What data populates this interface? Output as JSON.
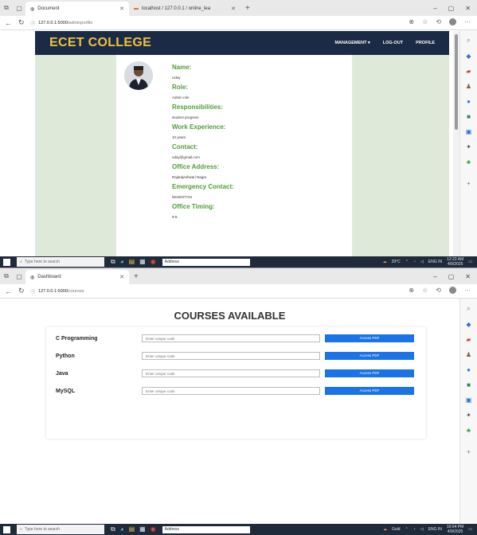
{
  "shot1": {
    "browser": {
      "tabs": [
        {
          "title": "Document",
          "active": true
        },
        {
          "title": "localhost / 127.0.0.1 / online_lea",
          "active": false
        }
      ],
      "url_host": "127.0.0.1:5000",
      "url_path": "/adminprofile"
    },
    "nav": {
      "brand": "ECET COLLEGE",
      "links": [
        "MANAGEMENT ▾",
        "LOG-OUT",
        "PROFILE"
      ]
    },
    "profile": [
      {
        "label": "Name:",
        "value": "Uday"
      },
      {
        "label": "Role:",
        "value": "Admin role"
      },
      {
        "label": "Responsibilities:",
        "value": "student progress"
      },
      {
        "label": "Work Experience:",
        "value": "10 years"
      },
      {
        "label": "Contact:",
        "value": "uday@gmail.com"
      },
      {
        "label": "Office Address:",
        "value": "Rajarajeshwari Nagar"
      },
      {
        "label": "Emergency Contact:",
        "value": "9618237734"
      },
      {
        "label": "Office Timing:",
        "value": "9-5"
      }
    ],
    "taskbar": {
      "search": "Type here to search",
      "address": "Address",
      "weather": "29°C",
      "lang": "ENG IN",
      "time": "12:22 AM",
      "date": "4/9/2025"
    }
  },
  "shot2": {
    "browser": {
      "tabs": [
        {
          "title": "Dashboard",
          "active": true
        }
      ],
      "url_host": "127.0.0.1:5000",
      "url_path": "/courses"
    },
    "title": "COURSES AVAILABLE",
    "courses": [
      {
        "name": "C Programming",
        "placeholder": "Enter unique code",
        "button": "Access PDF"
      },
      {
        "name": "Python",
        "placeholder": "Enter unique code",
        "button": "Access PDF"
      },
      {
        "name": "Java",
        "placeholder": "Enter unique code",
        "button": "Access PDF"
      },
      {
        "name": "MySQL",
        "placeholder": "Enter unique code",
        "button": "Access PDF"
      }
    ],
    "taskbar": {
      "search": "Type here to search",
      "address": "Address",
      "weather": "Gold",
      "lang": "ENG IN",
      "time": "10:04 PM",
      "date": "4/9/2025"
    }
  },
  "colors": {
    "navbar": "#1c2b45",
    "brand": "#f0c040",
    "label_green": "#4e9d3a",
    "content_bg": "#dfe9d9",
    "button_blue": "#1a73e8"
  }
}
